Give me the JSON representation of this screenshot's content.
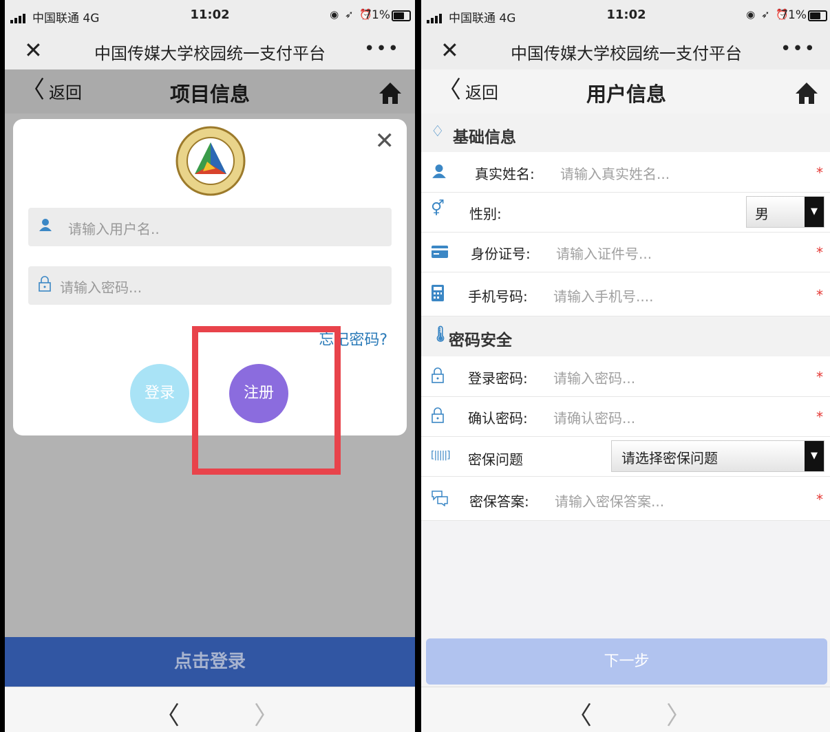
{
  "status": {
    "carrier": "中国联通",
    "network": "4G",
    "time": "11:02",
    "battery": "71%"
  },
  "wechat": {
    "title": "中国传媒大学校园统一支付平台",
    "close": "✕",
    "more": "•••"
  },
  "left": {
    "nav": {
      "back": "返回",
      "title": "项目信息"
    },
    "modal": {
      "username_placeholder": "请输入用户名..",
      "password_placeholder": "请输入密码...",
      "forgot": "忘记密码?",
      "login": "登录",
      "register": "注册"
    },
    "bottom_button": "点击登录"
  },
  "right": {
    "nav": {
      "back": "返回",
      "title": "用户信息"
    },
    "section_basic": "基础信息",
    "realname": {
      "label": "真实姓名:",
      "placeholder": "请输入真实姓名..."
    },
    "gender": {
      "label": "性别:",
      "value": "男"
    },
    "idnumber": {
      "label": "身份证号:",
      "placeholder": "请输入证件号..."
    },
    "phone": {
      "label": "手机号码:",
      "placeholder": "请输入手机号...."
    },
    "section_password": "密码安全",
    "login_password": {
      "label": "登录密码:",
      "placeholder": "请输入密码..."
    },
    "confirm_password": {
      "label": "确认密码:",
      "placeholder": "请确认密码..."
    },
    "security_question": {
      "label": "密保问题",
      "value": "请选择密保问题"
    },
    "security_answer": {
      "label": "密保答案:",
      "placeholder": "请输入密保答案..."
    },
    "required_mark": "*",
    "next": "下一步"
  },
  "colors": {
    "accent_blue": "#3156a3",
    "register_purple": "#8b6cde",
    "login_cyan": "#a9e3f6",
    "next_disabled": "#b1c3ef",
    "highlight_red": "#e8434b"
  }
}
